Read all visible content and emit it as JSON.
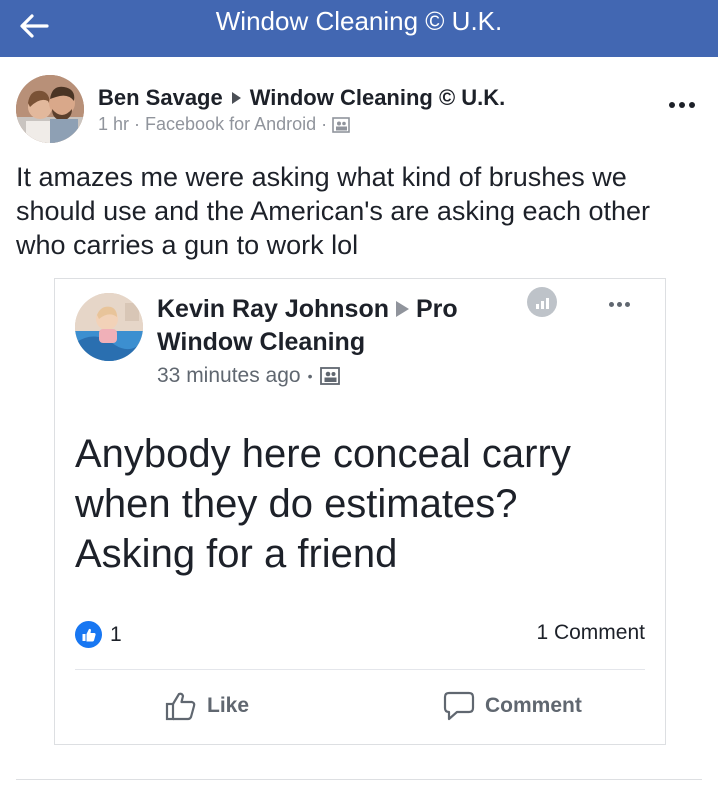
{
  "topbar": {
    "title": "Window Cleaning © U.K."
  },
  "post": {
    "author": "Ben Savage",
    "group": "Window Cleaning © U.K.",
    "time": "1 hr",
    "source": "Facebook for Android",
    "meta_separator": "·",
    "text": "It amazes me were asking what kind of brushes we should use and the American's are asking each other who carries a gun to work lol"
  },
  "shared": {
    "author": "Kevin Ray Johnson",
    "group": "Pro Window Cleaning",
    "time": "33 minutes ago",
    "meta_separator": "•",
    "text": "Anybody here conceal carry when they do estimates? Asking for a friend",
    "likes": "1",
    "comments": "1 Comment",
    "like_label": "Like",
    "comment_label": "Comment"
  },
  "colors": {
    "header_blue": "#4267b2",
    "like_blue": "#1877f2",
    "meta_gray": "#90949c"
  },
  "icons": [
    "back-arrow-icon",
    "more-icon",
    "group-privacy-icon",
    "stats-icon",
    "like-badge-icon",
    "thumbs-up-icon",
    "comment-bubble-icon"
  ]
}
